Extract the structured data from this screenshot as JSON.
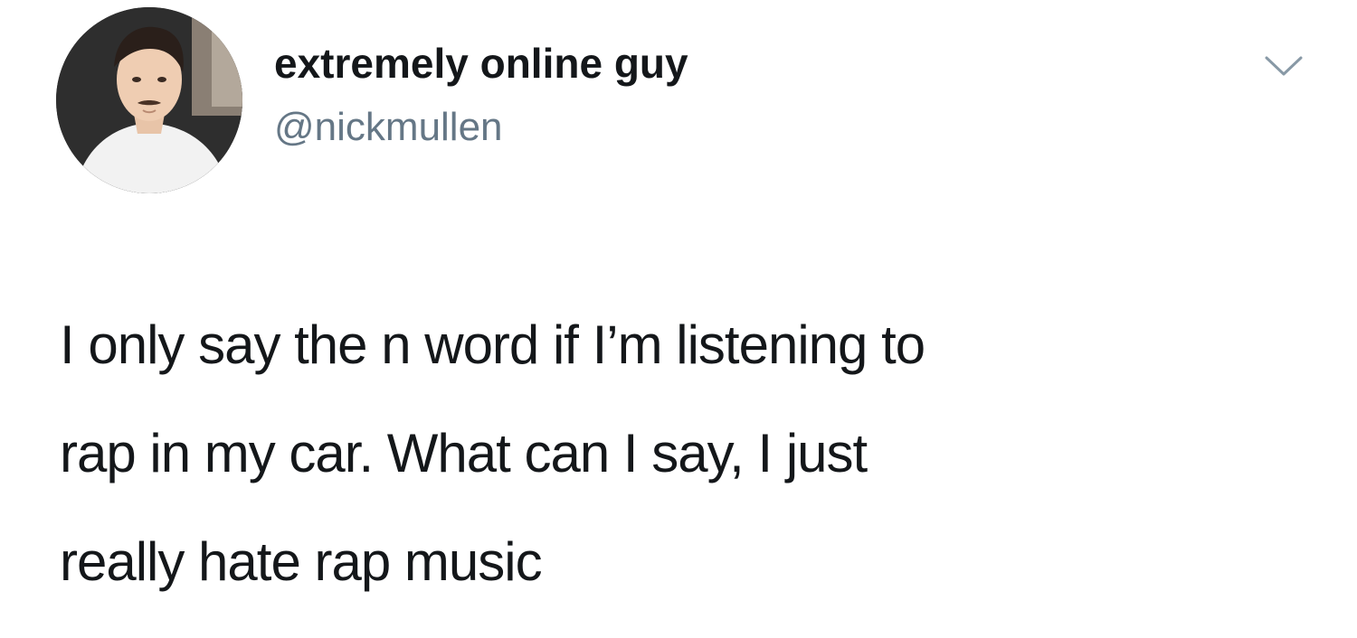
{
  "tweet": {
    "author": {
      "display_name": "extremely online guy",
      "handle": "@nickmullen"
    },
    "text_lines": [
      "I only say the n word if I’m listening to",
      "rap in my car. What can I say, I just",
      "really hate rap music"
    ],
    "menu_icon": "chevron-down-icon"
  },
  "colors": {
    "background": "#ffffff",
    "text_primary": "#14171a",
    "text_secondary": "#657786",
    "icon": "#8899a6"
  }
}
